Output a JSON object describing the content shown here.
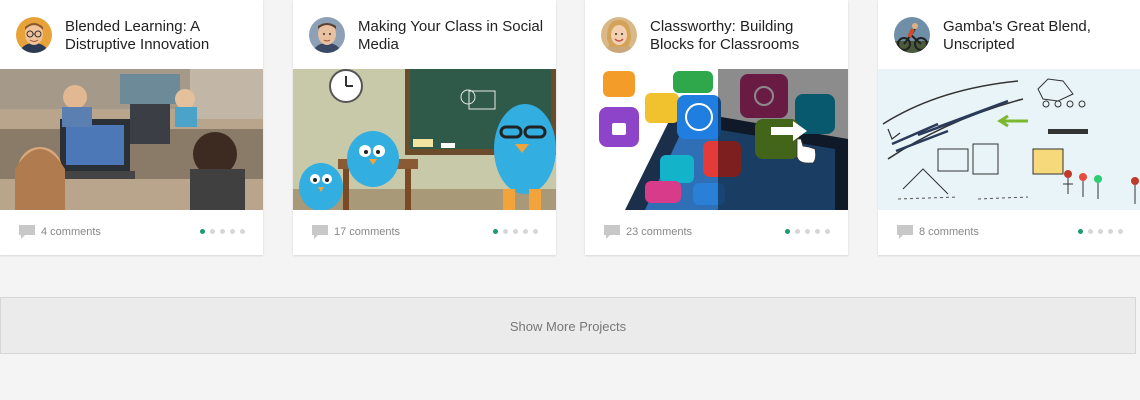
{
  "cards": [
    {
      "title": "Blended Learning: A Distruptive Innovation",
      "comments": "4 comments",
      "avatar_icon": "avatar-man-glasses-icon",
      "image_subject": "children-at-computers"
    },
    {
      "title": "Making Your Class in Social Media",
      "comments": "17 comments",
      "avatar_icon": "avatar-man-icon",
      "image_subject": "cartoon-birds-classroom"
    },
    {
      "title": "Classworthy: Building Blocks for Classrooms",
      "comments": "23 comments",
      "avatar_icon": "avatar-woman-icon",
      "image_subject": "app-icons-smartphone"
    },
    {
      "title": "Gamba's Great Blend, Unscripted",
      "comments": "8 comments",
      "avatar_icon": "avatar-cyclist-icon",
      "image_subject": "blended-learning-sketch"
    }
  ],
  "show_more_label": "Show More Projects",
  "colors": {
    "accent": "#1a9a74",
    "dot_inactive": "#d6d6d6",
    "background": "#f4f4f4"
  }
}
